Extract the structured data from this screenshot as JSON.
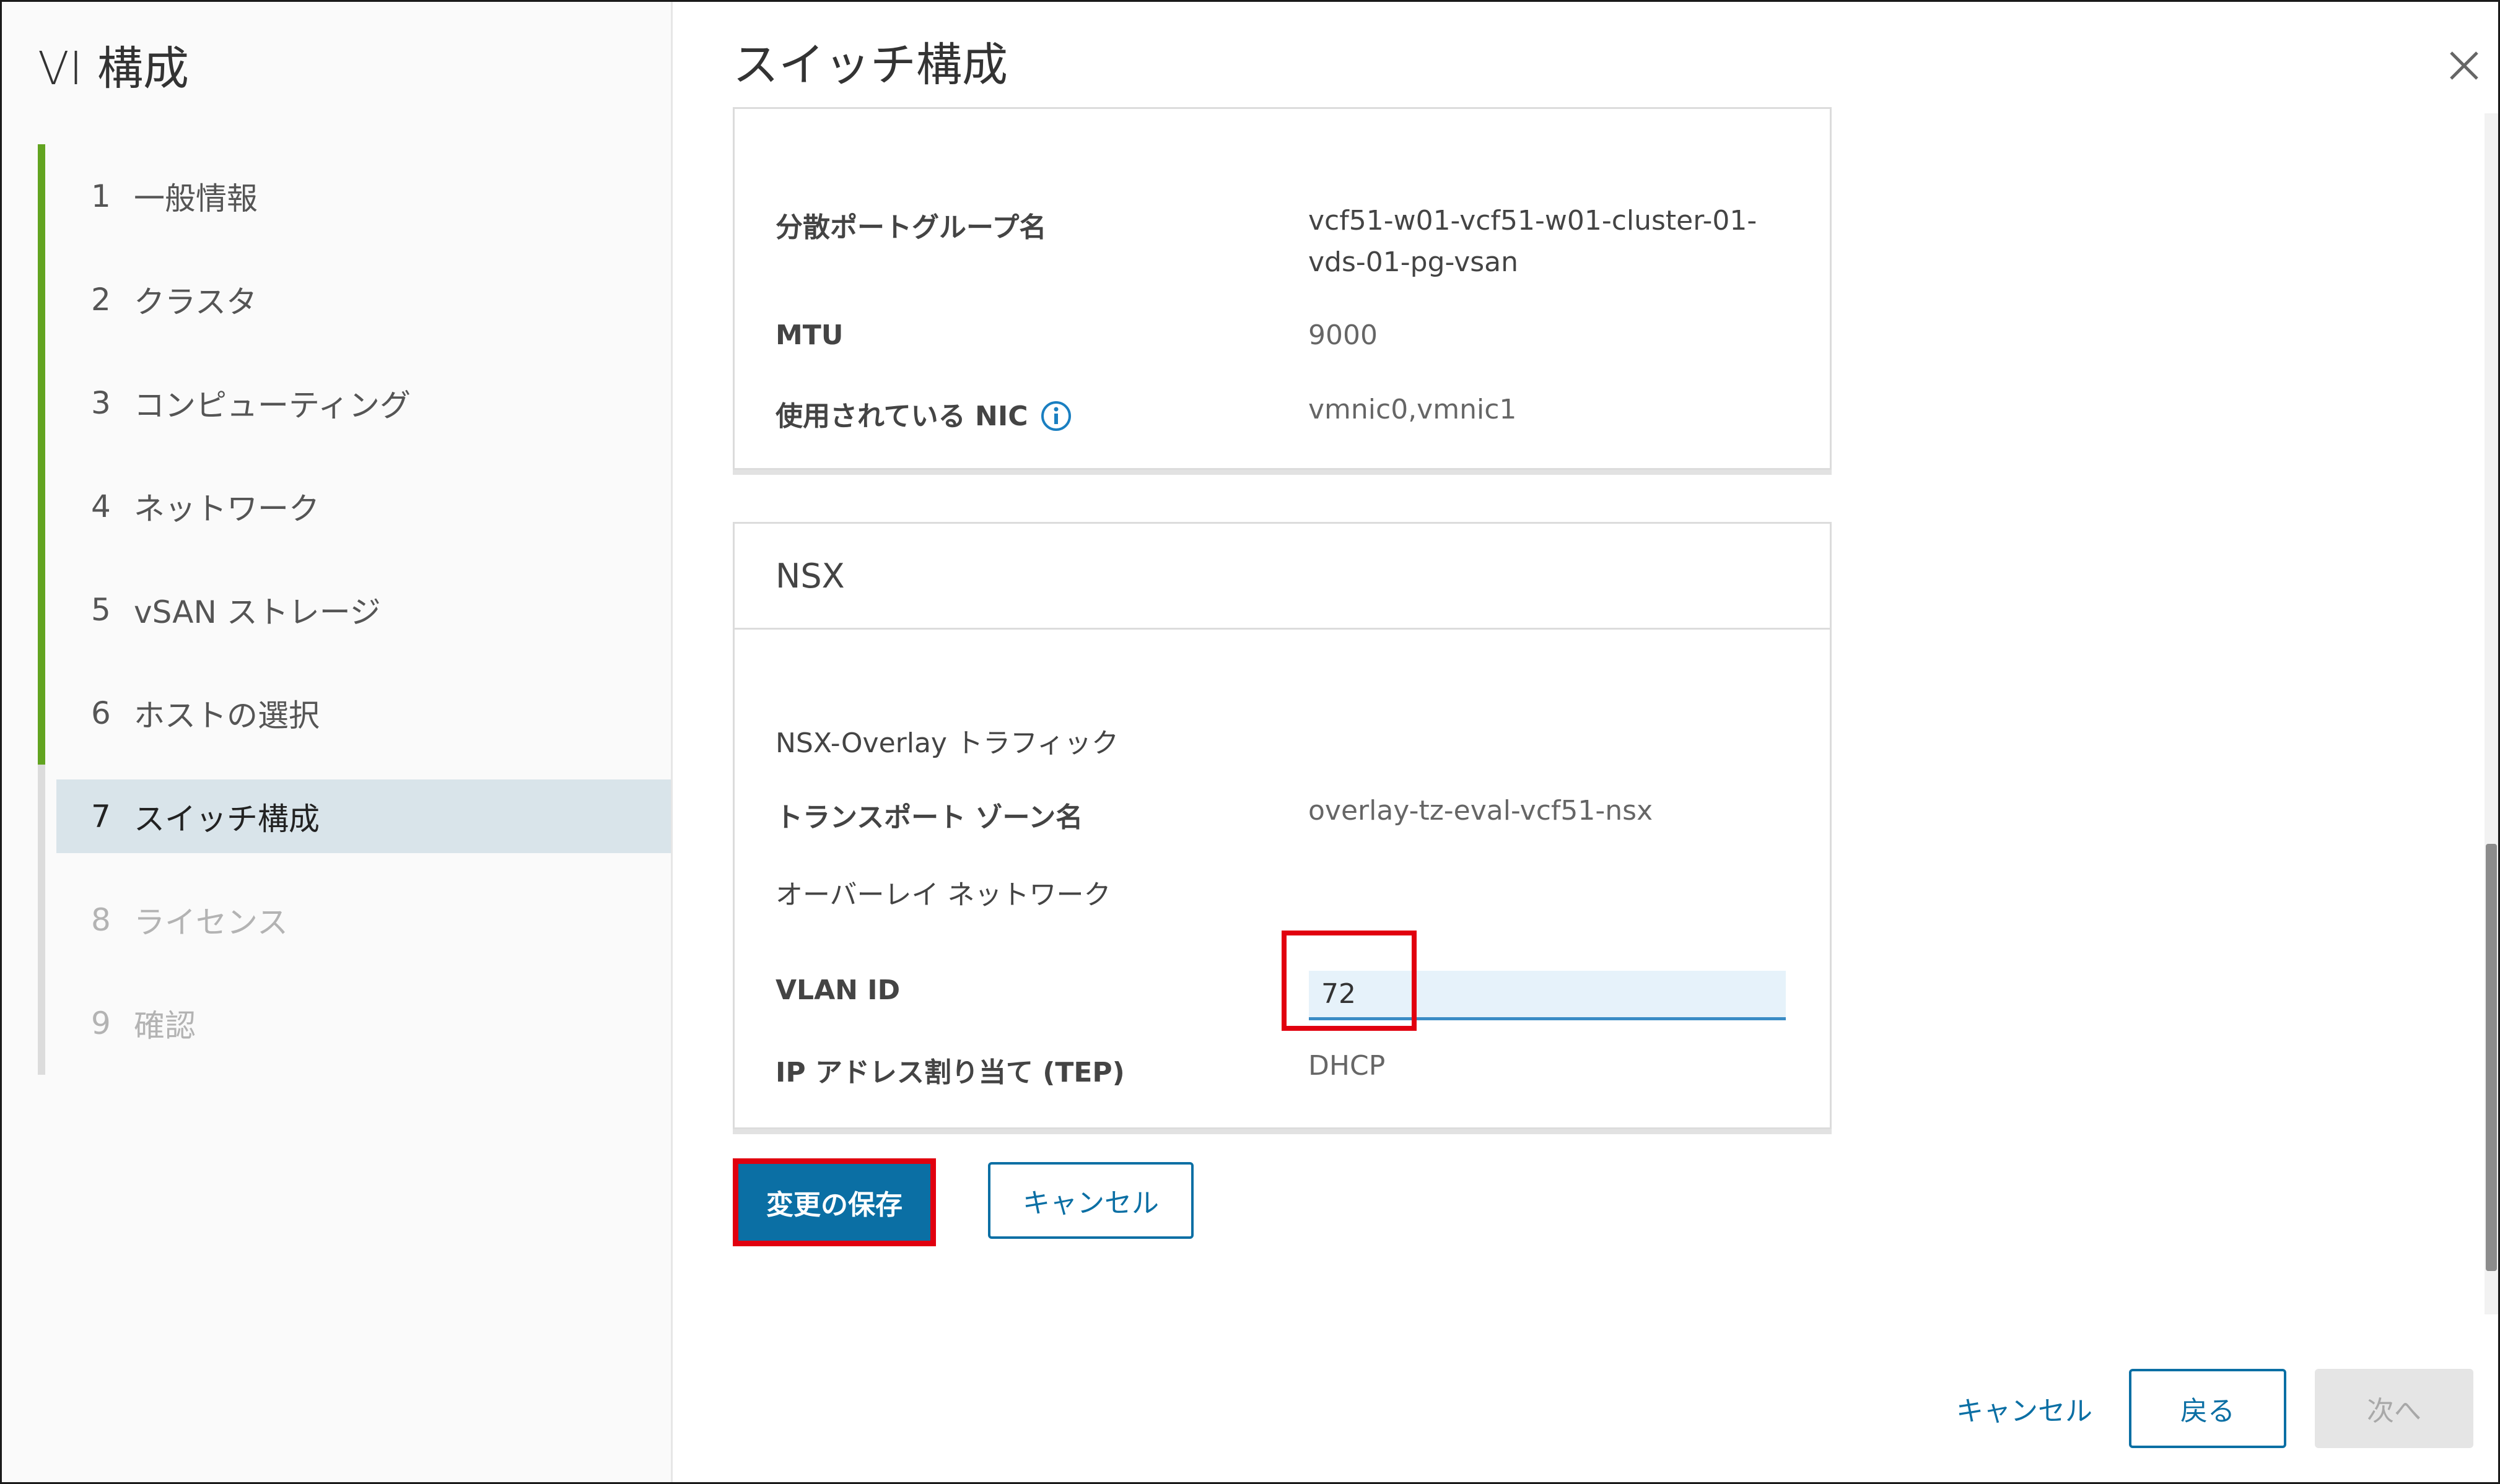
{
  "sidebar": {
    "title": "VI 構成",
    "steps": [
      {
        "num": "1",
        "label": "一般情報"
      },
      {
        "num": "2",
        "label": "クラスタ"
      },
      {
        "num": "3",
        "label": "コンピューティング"
      },
      {
        "num": "4",
        "label": "ネットワーク"
      },
      {
        "num": "5",
        "label": "vSAN ストレージ"
      },
      {
        "num": "6",
        "label": "ホストの選択"
      },
      {
        "num": "7",
        "label": "スイッチ構成"
      },
      {
        "num": "8",
        "label": "ライセンス"
      },
      {
        "num": "9",
        "label": "確認"
      }
    ]
  },
  "main": {
    "title": "スイッチ構成",
    "portgroup": {
      "name_label": "分散ポートグループ名",
      "name_value_line1": "vcf51-w01-vcf51-w01-cluster-01-",
      "name_value_line2": "vds-01-pg-vsan",
      "mtu_label": "MTU",
      "mtu_value": "9000",
      "nic_label": "使用されている NIC",
      "nic_value": "vmnic0,vmnic1"
    },
    "nsx": {
      "header": "NSX",
      "overlay_traffic": "NSX-Overlay トラフィック",
      "transport_zone_label": "トランスポート ゾーン名",
      "transport_zone_value": "overlay-tz-eval-vcf51-nsx",
      "overlay_network": "オーバーレイ ネットワーク",
      "vlan_label": "VLAN ID",
      "vlan_value": "72",
      "ip_label": "IP アドレス割り当て (TEP)",
      "ip_value": "DHCP"
    },
    "save_label": "変更の保存",
    "cancel_label": "キャンセル"
  },
  "footer": {
    "cancel_label": "キャンセル",
    "back_label": "戻る",
    "next_label": "次へ"
  },
  "colors": {
    "accent": "#0b6fa4",
    "done_step": "#62a420",
    "highlight_box": "#e1000f"
  }
}
